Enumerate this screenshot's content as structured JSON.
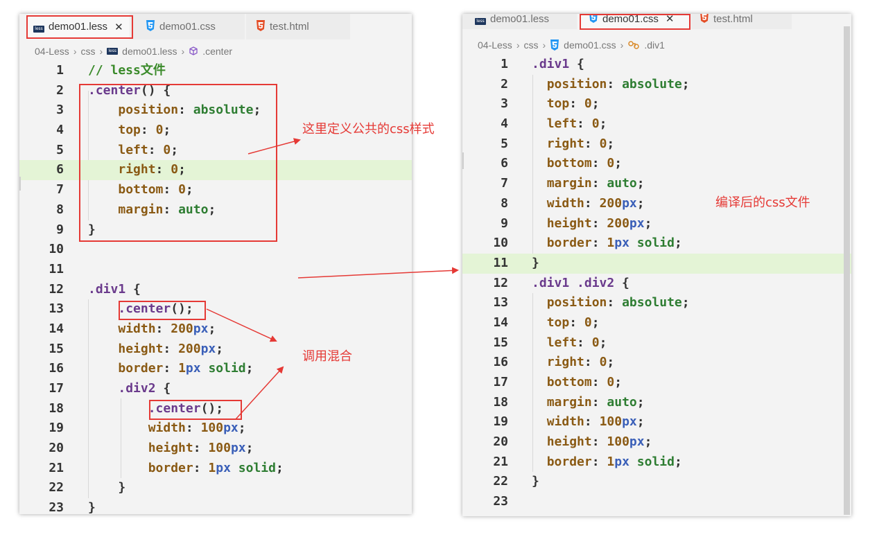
{
  "left_editor": {
    "tabs": [
      {
        "label": "demo01.less",
        "icon": "less-file-icon",
        "active": true,
        "close": "✕"
      },
      {
        "label": "demo01.css",
        "icon": "css3-file-icon",
        "active": false
      },
      {
        "label": "test.html",
        "icon": "html5-file-icon",
        "active": false
      }
    ],
    "breadcrumb": [
      "04-Less",
      "css",
      "demo01.less",
      ".center"
    ],
    "lines": [
      {
        "n": "1",
        "parts": [
          [
            "// less文件",
            "com"
          ]
        ]
      },
      {
        "n": "2",
        "parts": [
          [
            ".center",
            "sel"
          ],
          [
            "() {",
            "pun"
          ]
        ]
      },
      {
        "n": "3",
        "parts": [
          [
            "    ",
            "pun"
          ],
          [
            "position",
            "prop"
          ],
          [
            ": ",
            "pun"
          ],
          [
            "absolute",
            "val"
          ],
          [
            ";",
            "pun"
          ]
        ]
      },
      {
        "n": "4",
        "parts": [
          [
            "    ",
            "pun"
          ],
          [
            "top",
            "prop"
          ],
          [
            ": ",
            "pun"
          ],
          [
            "0",
            "num"
          ],
          [
            ";",
            "pun"
          ]
        ]
      },
      {
        "n": "5",
        "parts": [
          [
            "    ",
            "pun"
          ],
          [
            "left",
            "prop"
          ],
          [
            ": ",
            "pun"
          ],
          [
            "0",
            "num"
          ],
          [
            ";",
            "pun"
          ]
        ]
      },
      {
        "n": "6",
        "parts": [
          [
            "    ",
            "pun"
          ],
          [
            "right",
            "prop"
          ],
          [
            ": ",
            "pun"
          ],
          [
            "0",
            "num"
          ],
          [
            ";",
            "pun"
          ]
        ],
        "highlight": true
      },
      {
        "n": "7",
        "parts": [
          [
            "    ",
            "pun"
          ],
          [
            "bottom",
            "prop"
          ],
          [
            ": ",
            "pun"
          ],
          [
            "0",
            "num"
          ],
          [
            ";",
            "pun"
          ]
        ]
      },
      {
        "n": "8",
        "parts": [
          [
            "    ",
            "pun"
          ],
          [
            "margin",
            "prop"
          ],
          [
            ": ",
            "pun"
          ],
          [
            "auto",
            "val"
          ],
          [
            ";",
            "pun"
          ]
        ]
      },
      {
        "n": "9",
        "parts": [
          [
            "}",
            "pun"
          ]
        ]
      },
      {
        "n": "10",
        "parts": []
      },
      {
        "n": "11",
        "parts": []
      },
      {
        "n": "12",
        "parts": [
          [
            ".div1",
            "sel"
          ],
          [
            " {",
            "pun"
          ]
        ]
      },
      {
        "n": "13",
        "parts": [
          [
            "    ",
            "pun"
          ],
          [
            ".center",
            "sel"
          ],
          [
            "();",
            "pun"
          ]
        ]
      },
      {
        "n": "14",
        "parts": [
          [
            "    ",
            "pun"
          ],
          [
            "width",
            "prop"
          ],
          [
            ": ",
            "pun"
          ],
          [
            "200",
            "num"
          ],
          [
            "px",
            "unit"
          ],
          [
            ";",
            "pun"
          ]
        ]
      },
      {
        "n": "15",
        "parts": [
          [
            "    ",
            "pun"
          ],
          [
            "height",
            "prop"
          ],
          [
            ": ",
            "pun"
          ],
          [
            "200",
            "num"
          ],
          [
            "px",
            "unit"
          ],
          [
            ";",
            "pun"
          ]
        ]
      },
      {
        "n": "16",
        "parts": [
          [
            "    ",
            "pun"
          ],
          [
            "border",
            "prop"
          ],
          [
            ": ",
            "pun"
          ],
          [
            "1",
            "num"
          ],
          [
            "px",
            "unit"
          ],
          [
            " ",
            "pun"
          ],
          [
            "solid",
            "val"
          ],
          [
            ";",
            "pun"
          ]
        ]
      },
      {
        "n": "17",
        "parts": [
          [
            "    ",
            "pun"
          ],
          [
            ".div2",
            "sel"
          ],
          [
            " {",
            "pun"
          ]
        ]
      },
      {
        "n": "18",
        "parts": [
          [
            "        ",
            "pun"
          ],
          [
            ".center",
            "sel"
          ],
          [
            "();",
            "pun"
          ]
        ]
      },
      {
        "n": "19",
        "parts": [
          [
            "        ",
            "pun"
          ],
          [
            "width",
            "prop"
          ],
          [
            ": ",
            "pun"
          ],
          [
            "100",
            "num"
          ],
          [
            "px",
            "unit"
          ],
          [
            ";",
            "pun"
          ]
        ]
      },
      {
        "n": "20",
        "parts": [
          [
            "        ",
            "pun"
          ],
          [
            "height",
            "prop"
          ],
          [
            ": ",
            "pun"
          ],
          [
            "100",
            "num"
          ],
          [
            "px",
            "unit"
          ],
          [
            ";",
            "pun"
          ]
        ]
      },
      {
        "n": "21",
        "parts": [
          [
            "        ",
            "pun"
          ],
          [
            "border",
            "prop"
          ],
          [
            ": ",
            "pun"
          ],
          [
            "1",
            "num"
          ],
          [
            "px",
            "unit"
          ],
          [
            " ",
            "pun"
          ],
          [
            "solid",
            "val"
          ],
          [
            ";",
            "pun"
          ]
        ]
      },
      {
        "n": "22",
        "parts": [
          [
            "    ",
            "pun"
          ],
          [
            "}",
            "pun"
          ]
        ]
      },
      {
        "n": "23",
        "parts": [
          [
            "}",
            "pun"
          ]
        ]
      }
    ]
  },
  "right_editor": {
    "tabs": [
      {
        "label": "demo01.less",
        "icon": "less-file-icon",
        "active": false
      },
      {
        "label": "demo01.css",
        "icon": "css3-file-icon",
        "active": true,
        "close": "✕"
      },
      {
        "label": "test.html",
        "icon": "html5-file-icon",
        "active": false
      }
    ],
    "breadcrumb": [
      "04-Less",
      "css",
      "demo01.css",
      ".div1"
    ],
    "lines": [
      {
        "n": "1",
        "parts": [
          [
            ".div1",
            "sel"
          ],
          [
            " {",
            "pun"
          ]
        ]
      },
      {
        "n": "2",
        "parts": [
          [
            "  ",
            "pun"
          ],
          [
            "position",
            "prop"
          ],
          [
            ": ",
            "pun"
          ],
          [
            "absolute",
            "val"
          ],
          [
            ";",
            "pun"
          ]
        ]
      },
      {
        "n": "3",
        "parts": [
          [
            "  ",
            "pun"
          ],
          [
            "top",
            "prop"
          ],
          [
            ": ",
            "pun"
          ],
          [
            "0",
            "num"
          ],
          [
            ";",
            "pun"
          ]
        ]
      },
      {
        "n": "4",
        "parts": [
          [
            "  ",
            "pun"
          ],
          [
            "left",
            "prop"
          ],
          [
            ": ",
            "pun"
          ],
          [
            "0",
            "num"
          ],
          [
            ";",
            "pun"
          ]
        ]
      },
      {
        "n": "5",
        "parts": [
          [
            "  ",
            "pun"
          ],
          [
            "right",
            "prop"
          ],
          [
            ": ",
            "pun"
          ],
          [
            "0",
            "num"
          ],
          [
            ";",
            "pun"
          ]
        ]
      },
      {
        "n": "6",
        "parts": [
          [
            "  ",
            "pun"
          ],
          [
            "bottom",
            "prop"
          ],
          [
            ": ",
            "pun"
          ],
          [
            "0",
            "num"
          ],
          [
            ";",
            "pun"
          ]
        ]
      },
      {
        "n": "7",
        "parts": [
          [
            "  ",
            "pun"
          ],
          [
            "margin",
            "prop"
          ],
          [
            ": ",
            "pun"
          ],
          [
            "auto",
            "val"
          ],
          [
            ";",
            "pun"
          ]
        ]
      },
      {
        "n": "8",
        "parts": [
          [
            "  ",
            "pun"
          ],
          [
            "width",
            "prop"
          ],
          [
            ": ",
            "pun"
          ],
          [
            "200",
            "num"
          ],
          [
            "px",
            "unit"
          ],
          [
            ";",
            "pun"
          ]
        ]
      },
      {
        "n": "9",
        "parts": [
          [
            "  ",
            "pun"
          ],
          [
            "height",
            "prop"
          ],
          [
            ": ",
            "pun"
          ],
          [
            "200",
            "num"
          ],
          [
            "px",
            "unit"
          ],
          [
            ";",
            "pun"
          ]
        ]
      },
      {
        "n": "10",
        "parts": [
          [
            "  ",
            "pun"
          ],
          [
            "border",
            "prop"
          ],
          [
            ": ",
            "pun"
          ],
          [
            "1",
            "num"
          ],
          [
            "px",
            "unit"
          ],
          [
            " ",
            "pun"
          ],
          [
            "solid",
            "val"
          ],
          [
            ";",
            "pun"
          ]
        ]
      },
      {
        "n": "11",
        "parts": [
          [
            "}",
            "pun"
          ]
        ],
        "highlight": true
      },
      {
        "n": "12",
        "parts": [
          [
            ".div1 .div2",
            "sel"
          ],
          [
            " {",
            "pun"
          ]
        ]
      },
      {
        "n": "13",
        "parts": [
          [
            "  ",
            "pun"
          ],
          [
            "position",
            "prop"
          ],
          [
            ": ",
            "pun"
          ],
          [
            "absolute",
            "val"
          ],
          [
            ";",
            "pun"
          ]
        ]
      },
      {
        "n": "14",
        "parts": [
          [
            "  ",
            "pun"
          ],
          [
            "top",
            "prop"
          ],
          [
            ": ",
            "pun"
          ],
          [
            "0",
            "num"
          ],
          [
            ";",
            "pun"
          ]
        ]
      },
      {
        "n": "15",
        "parts": [
          [
            "  ",
            "pun"
          ],
          [
            "left",
            "prop"
          ],
          [
            ": ",
            "pun"
          ],
          [
            "0",
            "num"
          ],
          [
            ";",
            "pun"
          ]
        ]
      },
      {
        "n": "16",
        "parts": [
          [
            "  ",
            "pun"
          ],
          [
            "right",
            "prop"
          ],
          [
            ": ",
            "pun"
          ],
          [
            "0",
            "num"
          ],
          [
            ";",
            "pun"
          ]
        ]
      },
      {
        "n": "17",
        "parts": [
          [
            "  ",
            "pun"
          ],
          [
            "bottom",
            "prop"
          ],
          [
            ": ",
            "pun"
          ],
          [
            "0",
            "num"
          ],
          [
            ";",
            "pun"
          ]
        ]
      },
      {
        "n": "18",
        "parts": [
          [
            "  ",
            "pun"
          ],
          [
            "margin",
            "prop"
          ],
          [
            ": ",
            "pun"
          ],
          [
            "auto",
            "val"
          ],
          [
            ";",
            "pun"
          ]
        ]
      },
      {
        "n": "19",
        "parts": [
          [
            "  ",
            "pun"
          ],
          [
            "width",
            "prop"
          ],
          [
            ": ",
            "pun"
          ],
          [
            "100",
            "num"
          ],
          [
            "px",
            "unit"
          ],
          [
            ";",
            "pun"
          ]
        ]
      },
      {
        "n": "20",
        "parts": [
          [
            "  ",
            "pun"
          ],
          [
            "height",
            "prop"
          ],
          [
            ": ",
            "pun"
          ],
          [
            "100",
            "num"
          ],
          [
            "px",
            "unit"
          ],
          [
            ";",
            "pun"
          ]
        ]
      },
      {
        "n": "21",
        "parts": [
          [
            "  ",
            "pun"
          ],
          [
            "border",
            "prop"
          ],
          [
            ": ",
            "pun"
          ],
          [
            "1",
            "num"
          ],
          [
            "px",
            "unit"
          ],
          [
            " ",
            "pun"
          ],
          [
            "solid",
            "val"
          ],
          [
            ";",
            "pun"
          ]
        ]
      },
      {
        "n": "22",
        "parts": [
          [
            "}",
            "pun"
          ]
        ]
      },
      {
        "n": "23",
        "parts": []
      }
    ]
  },
  "annotations": {
    "define_mixin": "这里定义公共的css样式",
    "call_mixin": "调用混合",
    "compiled_file": "编译后的css文件"
  },
  "colors": {
    "annotation_red": "#e53935",
    "selector": "#6a3a8c",
    "property": "#8a5a14",
    "value": "#2e7d32",
    "unit": "#3a5fb8",
    "comment": "#3a8a2a",
    "line_highlight": "#e4f4d6"
  }
}
